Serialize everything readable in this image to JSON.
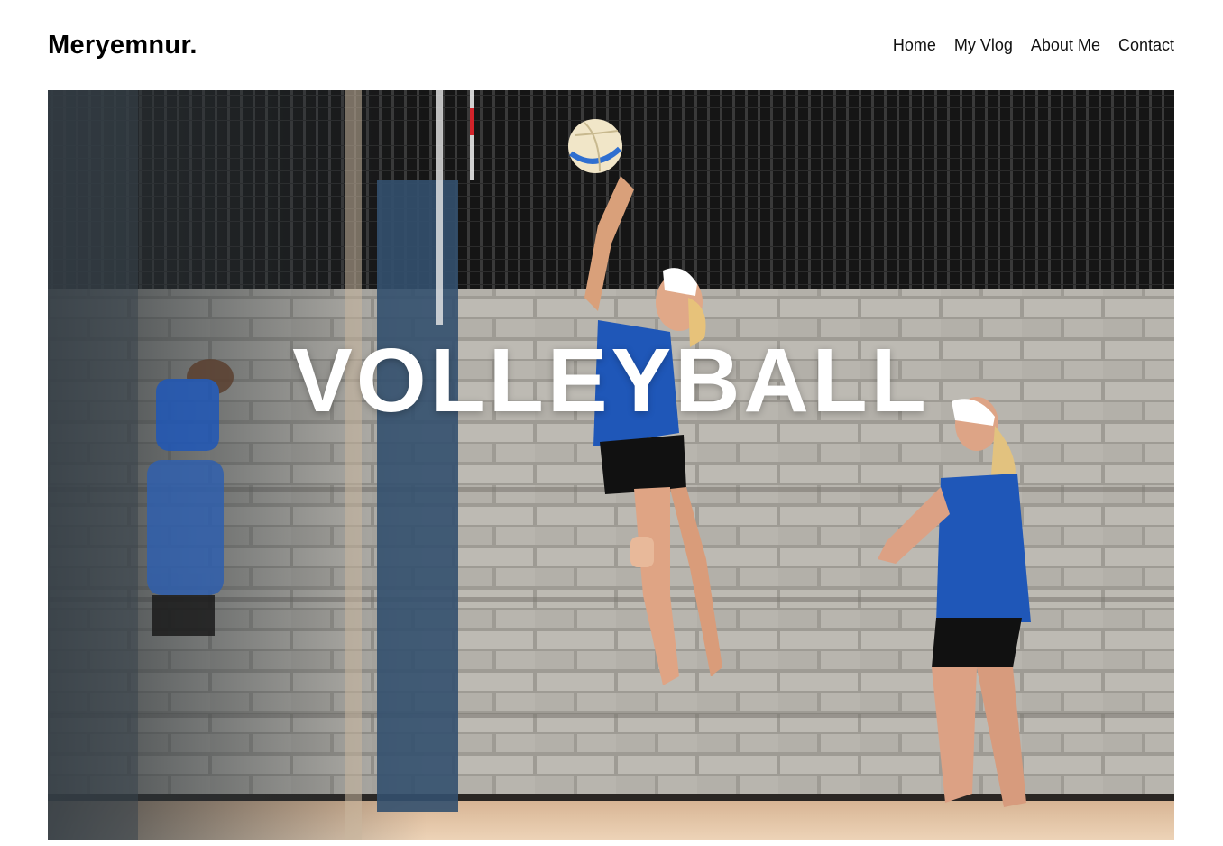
{
  "site": {
    "brand": "Meryemnur."
  },
  "nav": {
    "items": [
      {
        "label": "Home"
      },
      {
        "label": "My Vlog"
      },
      {
        "label": "About Me"
      },
      {
        "label": "Contact"
      }
    ]
  },
  "hero": {
    "title": "VOLLEYBALL",
    "overlay_color": "#ffffff",
    "jersey_color": "#1f57b8",
    "sand_color": "#e6c7a8",
    "wall_color": "#b9b6ae"
  }
}
